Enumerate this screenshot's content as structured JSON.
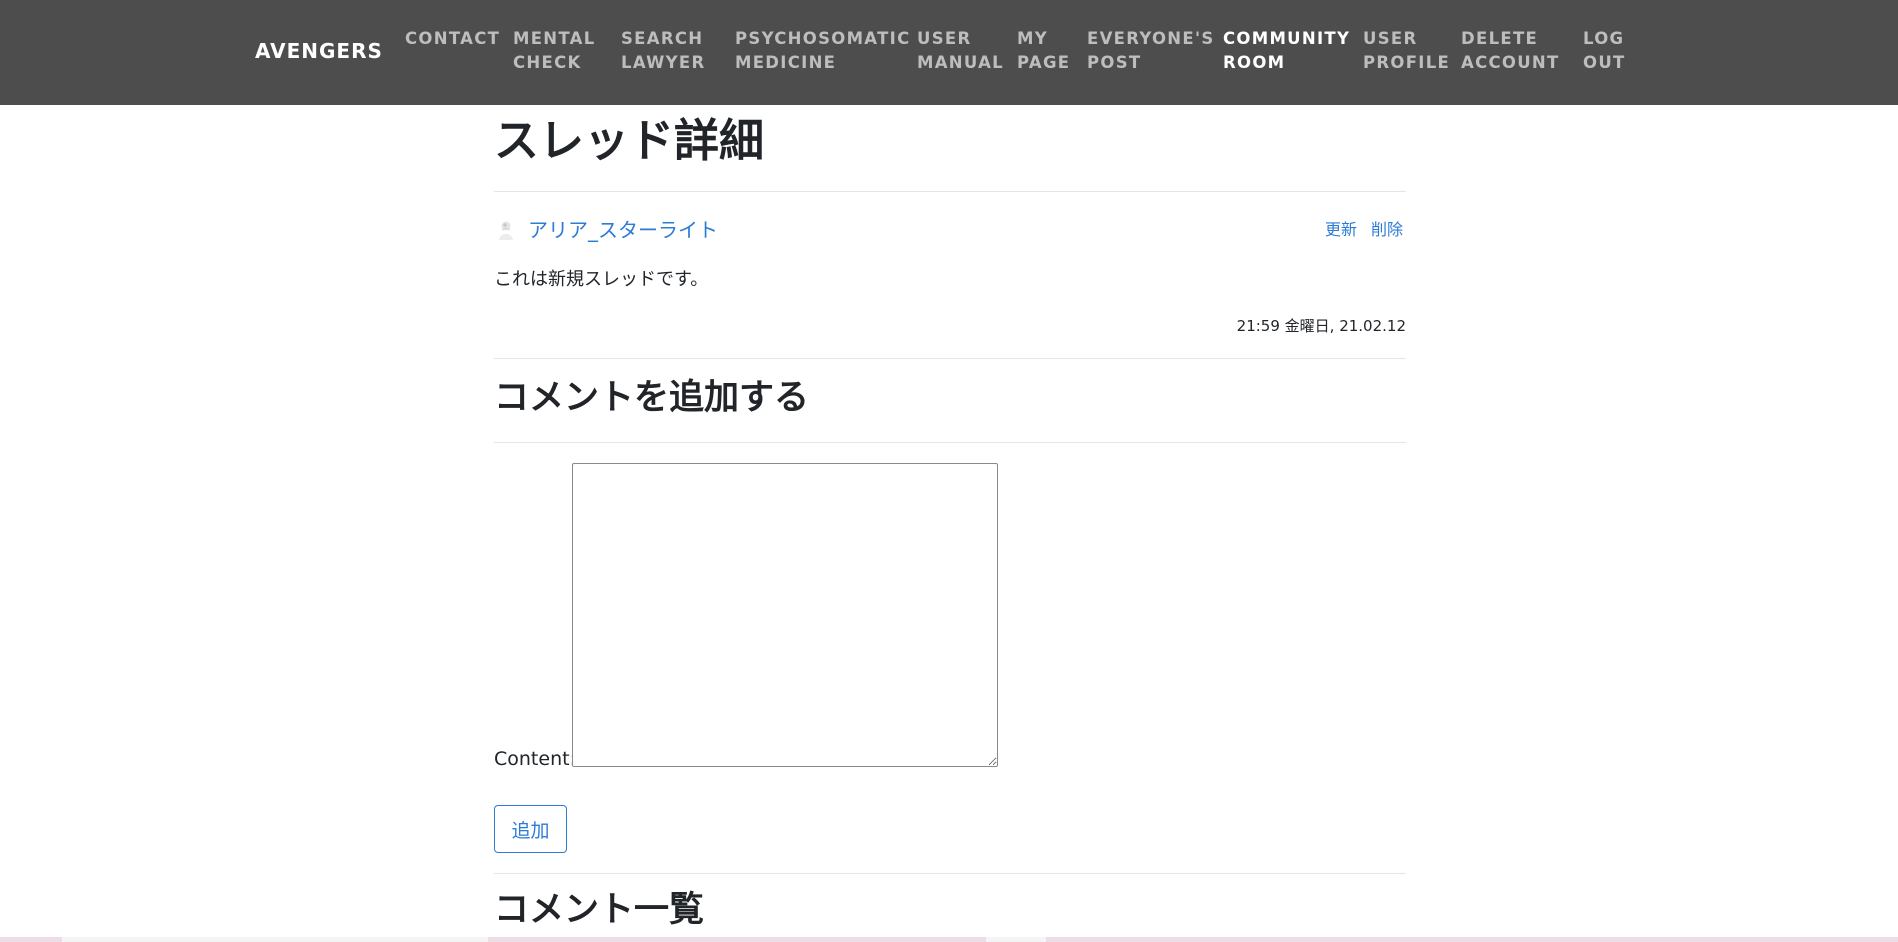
{
  "nav": {
    "brand": "AVENGERS",
    "items": [
      {
        "label": "CONTACT",
        "active": false
      },
      {
        "label": "MENTAL\nCHECK",
        "active": false
      },
      {
        "label": "SEARCH\nLAWYER",
        "active": false
      },
      {
        "label": "PSYCHOSOMATIC\nMEDICINE",
        "active": false
      },
      {
        "label": "USER\nMANUAL",
        "active": false
      },
      {
        "label": "MY\nPAGE",
        "active": false
      },
      {
        "label": "EVERYONE'S\nPOST",
        "active": false
      },
      {
        "label": "COMMUNITY\nROOM",
        "active": true
      },
      {
        "label": "USER\nPROFILE",
        "active": false
      },
      {
        "label": "DELETE\nACCOUNT",
        "active": false
      },
      {
        "label": "LOG\nOUT",
        "active": false
      }
    ]
  },
  "thread": {
    "title": "スレッド詳細",
    "author": "アリア_スターライト",
    "update_label": "更新",
    "delete_label": "削除",
    "body": "これは新規スレッドです。",
    "timestamp": "21:59 金曜日, 21.02.12"
  },
  "comment_form": {
    "title": "コメントを追加する",
    "content_label": "Content:",
    "content_value": "",
    "submit_label": "追加"
  },
  "comments": {
    "title": "コメント一覧"
  },
  "colors": {
    "navbar_bg": "#4d4d4d",
    "link": "#2c7cd6",
    "nav_text": "#bdbdbd",
    "nav_active": "#ffffff"
  },
  "icons": {
    "author_avatar": "avatar-icon"
  }
}
